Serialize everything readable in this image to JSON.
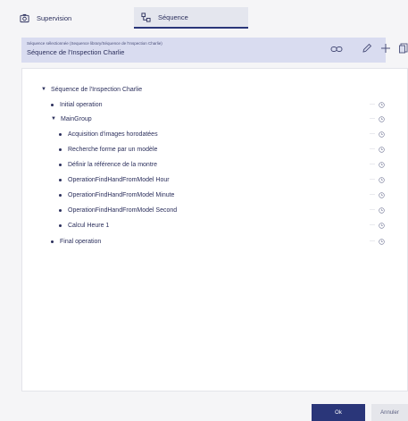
{
  "tabs": [
    {
      "label": "Supervision",
      "icon": "camera-icon"
    },
    {
      "label": "Séquence",
      "icon": "sequence-icon"
    }
  ],
  "selection": {
    "caption": "Séquence sélectionnée (Sequence library/Séquence de l'Inspection Charlie)",
    "value": "Séquence de l'Inspection Charlie"
  },
  "toolbar": {
    "icons": [
      "link-icon",
      "pencil-icon",
      "plus-icon",
      "copy-icon"
    ]
  },
  "tree": {
    "root": "Séquence de l'Inspection Charlie",
    "initial": "Initial operation",
    "group": "MainGroup",
    "children": [
      "Acquisition d'images horodatées",
      "Recherche forme par un modèle",
      "Définir la référence de la montre",
      "OperationFindHandFromModel Hour",
      "OperationFindHandFromModel Minute",
      "OperationFindHandFromModel Second",
      "Calcul Heure 1"
    ],
    "final": "Final operation",
    "more_glyph": "···"
  },
  "footer": {
    "ok_label": "Ok",
    "cancel_label": "Annuler"
  },
  "colors": {
    "accent": "#2a3679",
    "selection_bg": "#d9dcf0",
    "text": "#2b2f5c"
  }
}
